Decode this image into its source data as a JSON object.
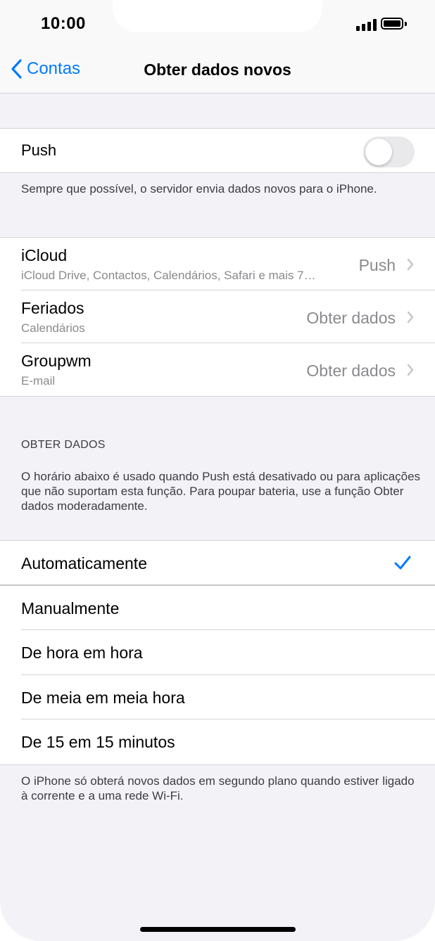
{
  "status": {
    "time": "10:00"
  },
  "nav": {
    "back_label": "Contas",
    "title": "Obter dados novos"
  },
  "push": {
    "label": "Push",
    "enabled": false,
    "footnote": "Sempre que possível, o servidor envia dados novos para o iPhone."
  },
  "accounts": [
    {
      "title": "iCloud",
      "subtitle": "iCloud Drive, Contactos, Calendários, Safari e mais 7…",
      "value": "Push"
    },
    {
      "title": "Feriados",
      "subtitle": "Calendários",
      "value": "Obter dados"
    },
    {
      "title": "Groupwm",
      "subtitle": "E-mail",
      "value": "Obter dados"
    }
  ],
  "fetch": {
    "header": "OBTER DADOS",
    "description": "O horário abaixo é usado quando Push está desativado ou para aplicações que não suportam esta função. Para poupar bateria, use a função Obter dados moderadamente.",
    "options": [
      {
        "label": "Automaticamente",
        "selected": true
      },
      {
        "label": "Manualmente",
        "selected": false
      },
      {
        "label": "De hora em hora",
        "selected": false
      },
      {
        "label": "De meia em meia hora",
        "selected": false
      },
      {
        "label": "De 15 em 15 minutos",
        "selected": false
      }
    ],
    "footnote": "O iPhone só obterá novos dados em segundo plano quando estiver ligado à corrente e a uma rede Wi-Fi."
  },
  "colors": {
    "accent": "#007aff",
    "background": "#f2f2f7",
    "secondary_text": "#8a8a8e"
  }
}
